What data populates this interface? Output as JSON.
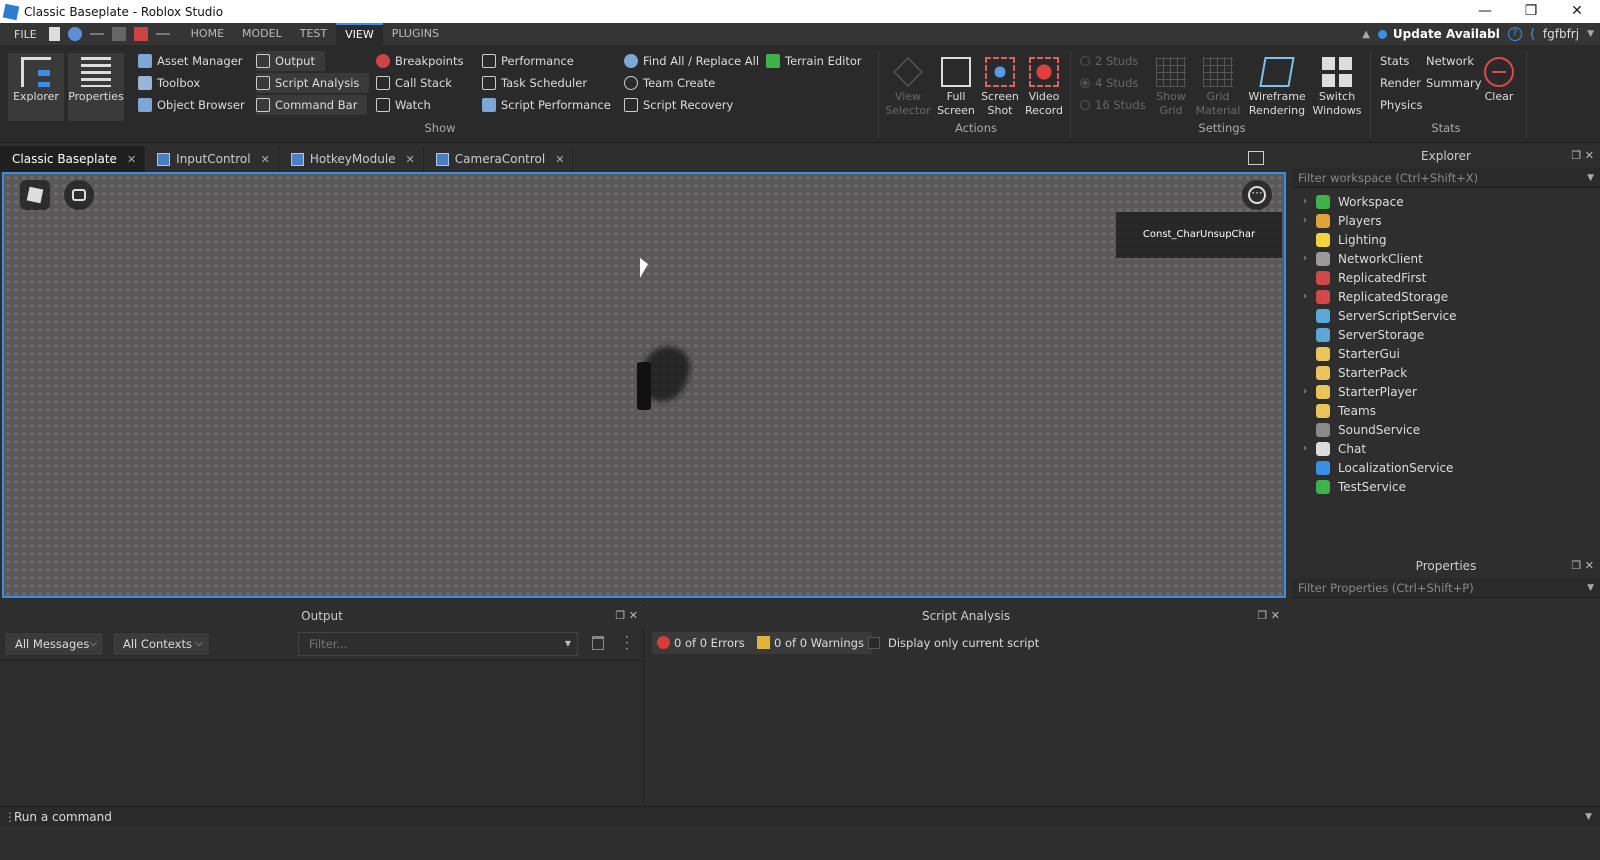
{
  "window": {
    "title": "Classic Baseplate - Roblox Studio",
    "min": "—",
    "max": "❐",
    "close": "✕"
  },
  "menu": {
    "file": "FILE",
    "tabs": [
      "HOME",
      "MODEL",
      "TEST",
      "VIEW",
      "PLUGINS"
    ],
    "active_tab": "VIEW",
    "update": "Update Availabl",
    "help": "?",
    "user": "fgfbfrj"
  },
  "ribbon": {
    "explorer": "Explorer",
    "properties": "Properties",
    "asset_manager": "Asset Manager",
    "toolbox": "Toolbox",
    "object_browser": "Object Browser",
    "output": "Output",
    "script_analysis": "Script Analysis",
    "command_bar": "Command Bar",
    "breakpoints": "Breakpoints",
    "call_stack": "Call Stack",
    "watch": "Watch",
    "performance": "Performance",
    "task_scheduler": "Task Scheduler",
    "script_performance": "Script Performance",
    "find_all": "Find All / Replace All",
    "team_create": "Team Create",
    "script_recovery": "Script Recovery",
    "terrain_editor": "Terrain Editor",
    "show_group": "Show",
    "view_selector": [
      "View",
      "Selector"
    ],
    "full_screen": [
      "Full",
      "Screen"
    ],
    "screen_shot": [
      "Screen",
      "Shot"
    ],
    "video_record": [
      "Video",
      "Record"
    ],
    "actions_group": "Actions",
    "studs_2": "2 Studs",
    "studs_4": "4 Studs",
    "studs_16": "16 Studs",
    "show_grid": [
      "Show",
      "Grid"
    ],
    "grid_material": [
      "Grid",
      "Material"
    ],
    "wireframe": [
      "Wireframe",
      "Rendering"
    ],
    "switch_windows": [
      "Switch",
      "Windows"
    ],
    "settings_group": "Settings",
    "stats": "Stats",
    "network": "Network",
    "render": "Render",
    "summary": "Summary",
    "physics": "Physics",
    "clear": "Clear",
    "stats_group": "Stats"
  },
  "doc_tabs": [
    {
      "label": "Classic Baseplate",
      "active": true
    },
    {
      "label": "InputControl",
      "active": false
    },
    {
      "label": "HotkeyModule",
      "active": false
    },
    {
      "label": "CameraControl",
      "active": false
    }
  ],
  "viewport": {
    "label": "Const_CharUnsupChar"
  },
  "explorer": {
    "title": "Explorer",
    "filter_placeholder": "Filter workspace (Ctrl+Shift+X)",
    "items": [
      {
        "label": "Workspace",
        "expandable": true,
        "color": "#3db24b"
      },
      {
        "label": "Players",
        "expandable": true,
        "color": "#e0a33a"
      },
      {
        "label": "Lighting",
        "expandable": false,
        "color": "#f2d33c"
      },
      {
        "label": "NetworkClient",
        "expandable": true,
        "color": "#9a9a9a"
      },
      {
        "label": "ReplicatedFirst",
        "expandable": false,
        "color": "#d04848"
      },
      {
        "label": "ReplicatedStorage",
        "expandable": true,
        "color": "#d04848"
      },
      {
        "label": "ServerScriptService",
        "expandable": false,
        "color": "#5aa7d8"
      },
      {
        "label": "ServerStorage",
        "expandable": false,
        "color": "#5aa7d8"
      },
      {
        "label": "StarterGui",
        "expandable": false,
        "color": "#e8c45a"
      },
      {
        "label": "StarterPack",
        "expandable": false,
        "color": "#e8c45a"
      },
      {
        "label": "StarterPlayer",
        "expandable": true,
        "color": "#e8c45a"
      },
      {
        "label": "Teams",
        "expandable": false,
        "color": "#e8c45a"
      },
      {
        "label": "SoundService",
        "expandable": false,
        "color": "#8a8a8a"
      },
      {
        "label": "Chat",
        "expandable": true,
        "color": "#dcdcdc"
      },
      {
        "label": "LocalizationService",
        "expandable": false,
        "color": "#3a8ee6"
      },
      {
        "label": "TestService",
        "expandable": false,
        "color": "#3db24b"
      }
    ]
  },
  "properties": {
    "title": "Properties",
    "filter_placeholder": "Filter Properties (Ctrl+Shift+P)"
  },
  "output": {
    "title": "Output",
    "messages": "All Messages",
    "contexts": "All Contexts",
    "filter_placeholder": "Filter..."
  },
  "script_analysis": {
    "title": "Script Analysis",
    "errors": "0 of 0 Errors",
    "warnings": "0 of 0 Warnings",
    "only_current": "Display only current script"
  },
  "command_bar": {
    "placeholder": "Run a command"
  }
}
